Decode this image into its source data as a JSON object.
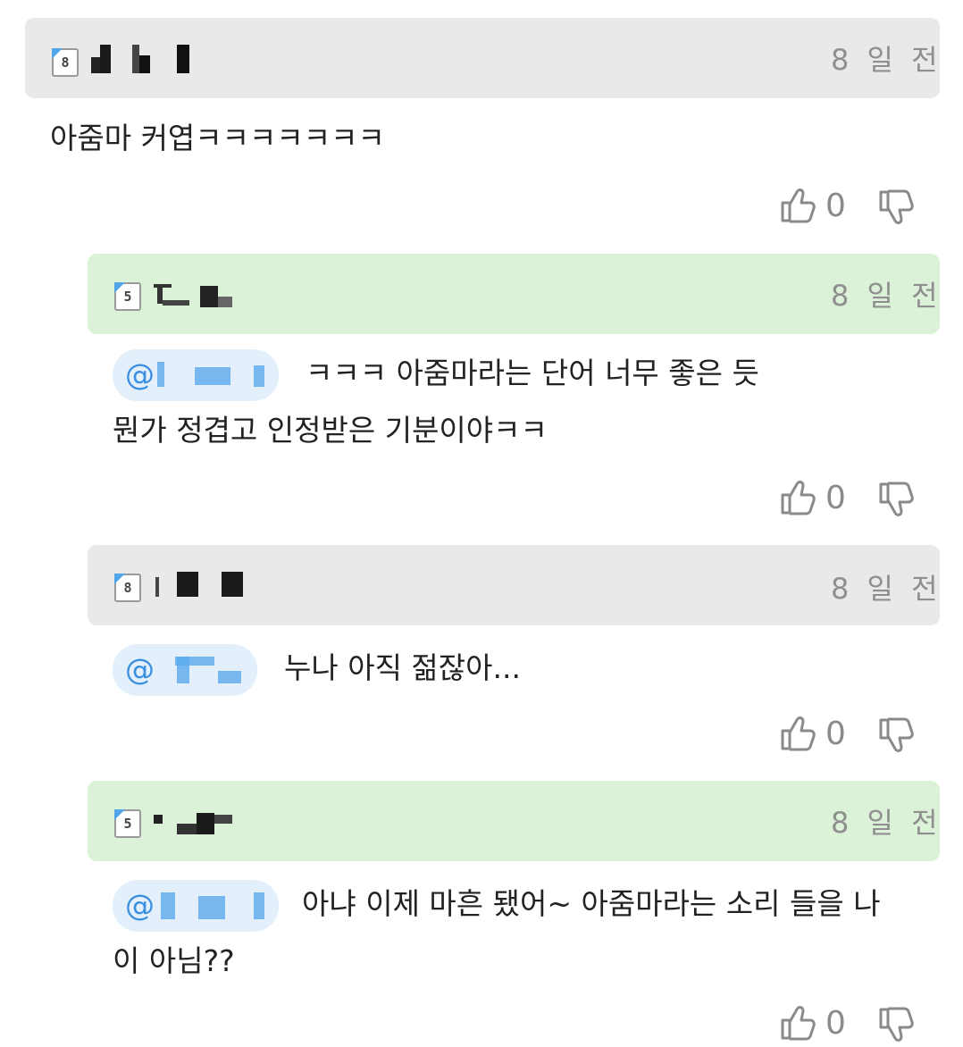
{
  "comments": [
    {
      "badge": "8",
      "time": "8 일 전",
      "text": "아줌마 커엽ㅋㅋㅋㅋㅋㅋㅋ",
      "up": "0"
    },
    {
      "badge": "5",
      "time": "8 일 전",
      "mention": "@",
      "text": "ㅋㅋㅋ 아줌마라는 단어 너무 좋은 듯",
      "text2": "뭔가 정겹고 인정받은 기분이야ㅋㅋ",
      "up": "0"
    },
    {
      "badge": "8",
      "time": "8 일 전",
      "mention": "@",
      "text": "누나 아직 젊잖아...",
      "up": "0"
    },
    {
      "badge": "5",
      "time": "8 일 전",
      "mention": "@",
      "text": "아냐 이제 마흔 됐어~ 아줌마라는 소리 들을 나",
      "text2": "이 아님??",
      "up": "0"
    }
  ]
}
